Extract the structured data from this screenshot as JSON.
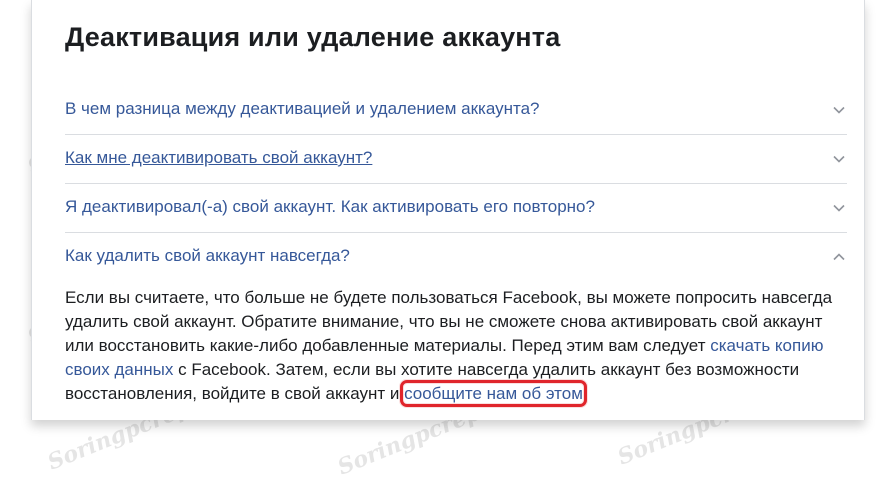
{
  "page": {
    "title": "Деактивация или удаление аккаунта"
  },
  "faq": {
    "items": [
      {
        "question": "В чем разница между деактивацией и удалением аккаунта?",
        "expanded": false
      },
      {
        "question": "Как мне деактивировать свой аккаунт?",
        "expanded": false
      },
      {
        "question": "Я деактивировал(-а) свой аккаунт. Как активировать его повторно?",
        "expanded": false
      },
      {
        "question": "Как удалить свой аккаунт навсегда?",
        "expanded": true
      }
    ],
    "answer": {
      "part1": "Если вы считаете, что больше не будете пользоваться Facebook, вы можете попросить навсегда удалить свой аккаунт. Обратите внимание, что вы не сможете снова активировать свой аккаунт или восстановить какие-либо добавленные материалы. Перед этим вам следует ",
      "link_download": "скачать копию своих данных",
      "part2": " с Facebook. Затем, если вы хотите навсегда удалить аккаунт без возможности восстановления, войдите в свой аккаунт и ",
      "link_contact": "сообщите нам об этом",
      "part3": "."
    }
  },
  "watermark": {
    "text": "Soringpcrepair.com"
  },
  "colors": {
    "link": "#365899",
    "text": "#1c1e21",
    "highlight": "#e0252b",
    "divider": "#dadde1"
  }
}
